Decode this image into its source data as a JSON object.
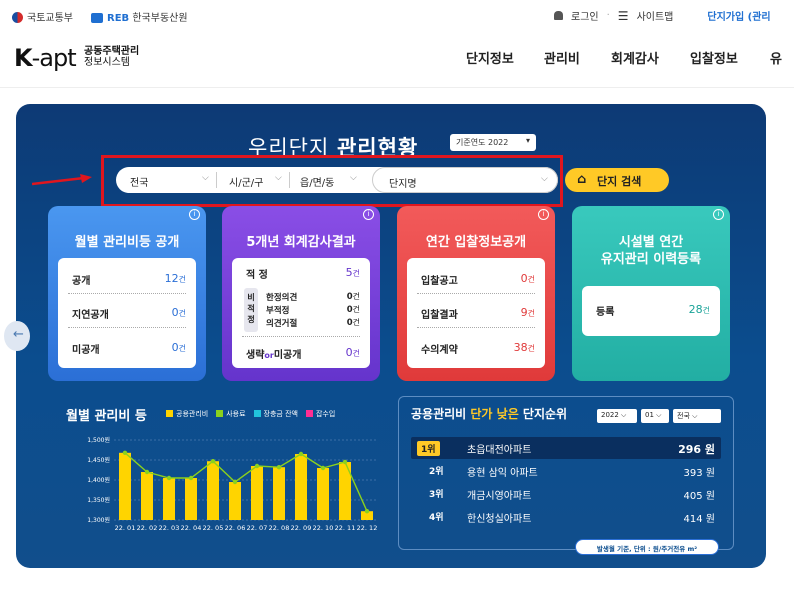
{
  "topbar": {
    "org1": "국토교통부",
    "org2": "한국부동산원",
    "org2_logo": "REB",
    "login": "로그인",
    "sitemap": "사이트맵",
    "join": "단지가입 (관리"
  },
  "header": {
    "logo_k": "K",
    "logo_apt": "-apt",
    "logo_sub1": "공동주택관리",
    "logo_sub2": "정보시스템",
    "nav": [
      "단지정보",
      "관리비",
      "회계감사",
      "입찰정보",
      "유"
    ]
  },
  "hero": {
    "title_light": "우리단지",
    "title_bold": "관리현황",
    "year_label": "기준연도 2022",
    "search": {
      "sido": "전국",
      "sigungu": "시/군/구",
      "eupmyeondong": "읍/면/동",
      "complex": "단지명",
      "button": "단지 검색"
    }
  },
  "cards": [
    {
      "title": "월별 관리비등 공개",
      "rows": [
        {
          "label": "공개",
          "value": "12",
          "unit": "건"
        },
        {
          "label": "지연공개",
          "value": "0",
          "unit": "건"
        },
        {
          "label": "미공개",
          "value": "0",
          "unit": "건"
        }
      ]
    },
    {
      "title": "5개년 회계감사결과",
      "proper": {
        "label": "적 정",
        "value": "5",
        "unit": "건"
      },
      "nonproper_label": "비적정",
      "sub": [
        {
          "label": "한정의견",
          "value": "0",
          "unit": "건"
        },
        {
          "label": "부적정",
          "value": "0",
          "unit": "건"
        },
        {
          "label": "의견거절",
          "value": "0",
          "unit": "건"
        }
      ],
      "omit": {
        "label_a": "생략",
        "label_or": "or",
        "label_b": "미공개",
        "value": "0",
        "unit": "건"
      }
    },
    {
      "title": "연간 입찰정보공개",
      "rows": [
        {
          "label": "입찰공고",
          "value": "0",
          "unit": "건"
        },
        {
          "label": "입찰결과",
          "value": "9",
          "unit": "건"
        },
        {
          "label": "수의계약",
          "value": "38",
          "unit": "건"
        }
      ]
    },
    {
      "title_line1": "시설별 연간",
      "title_line2": "유지관리 이력등록",
      "rows": [
        {
          "label": "등록",
          "value": "28",
          "unit": "건"
        }
      ]
    }
  ],
  "colors": {
    "card1": "#3f8ce8",
    "card2": "#7b45d8",
    "card3": "#ee4d4d",
    "card4": "#2bbdb1",
    "accent": "#ffc926",
    "red": "#e0161e"
  },
  "chart_data": {
    "type": "bar",
    "title": "월별 관리비 등",
    "legend": [
      {
        "name": "공용관리비",
        "color": "#ffd400"
      },
      {
        "name": "사용료",
        "color": "#8bd11d"
      },
      {
        "name": "장충금 잔액",
        "color": "#22c4dc"
      },
      {
        "name": "잡수입",
        "color": "#ff2e93"
      }
    ],
    "yticks": [
      "1,500원",
      "1,450원",
      "1,400원",
      "1,350원",
      "1,300원"
    ],
    "ylim": [
      1300,
      1500
    ],
    "categories": [
      "22. 01",
      "22. 02",
      "22. 03",
      "22. 04",
      "22. 05",
      "22. 06",
      "22. 07",
      "22. 08",
      "22. 09",
      "22. 10",
      "22. 11",
      "22. 12"
    ],
    "values": [
      1468,
      1420,
      1405,
      1405,
      1447,
      1395,
      1435,
      1432,
      1465,
      1430,
      1445,
      1322
    ]
  },
  "ranking": {
    "title_a": "공용관리비",
    "title_hl": "단가 낮은",
    "title_b": "단지순위",
    "filters": [
      "2022",
      "01",
      "전국"
    ],
    "items": [
      {
        "rank": "1위",
        "name": "초읍대전아파트",
        "value": "296 원"
      },
      {
        "rank": "2위",
        "name": "용현 삼익 아파트",
        "value": "393 원"
      },
      {
        "rank": "3위",
        "name": "개금시영아파트",
        "value": "405 원"
      },
      {
        "rank": "4위",
        "name": "한신청실아파트",
        "value": "414 원"
      }
    ],
    "note": "발생월 기준, 단위 : 원/주거전유 m²"
  }
}
